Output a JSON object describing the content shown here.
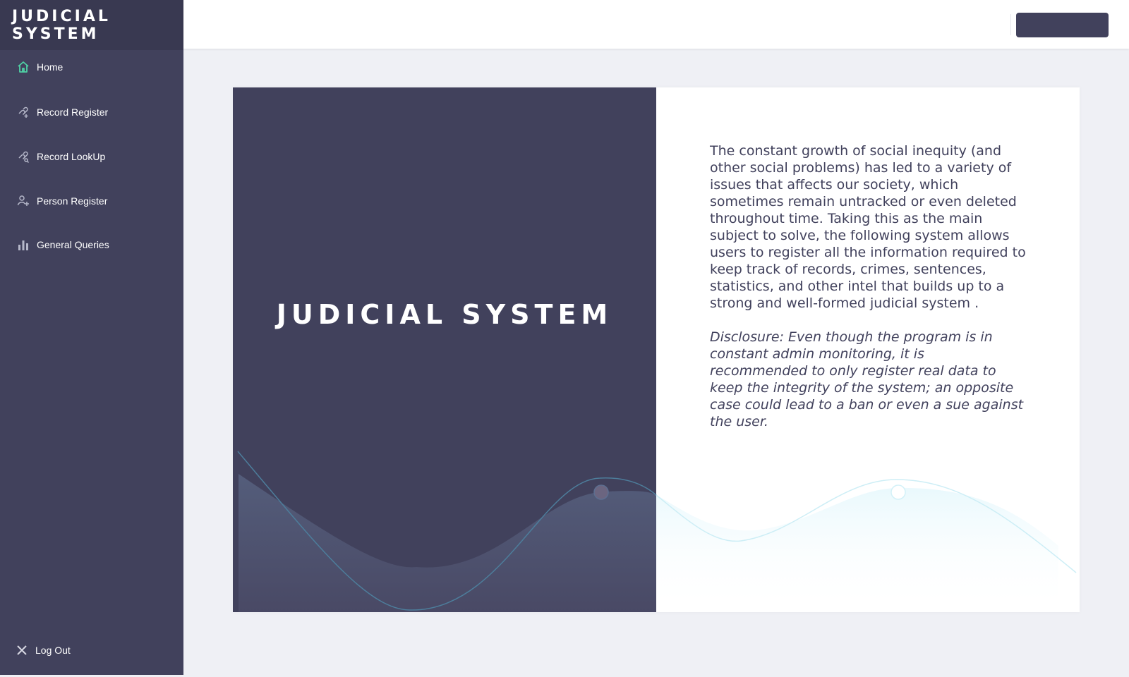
{
  "app": {
    "brand": "JUDICIAL SYSTEM"
  },
  "sidebar": {
    "items": [
      {
        "label": "Home",
        "icon": "home-icon",
        "active": true
      },
      {
        "label": "Record Register",
        "icon": "link-add-icon"
      },
      {
        "label": "Record LookUp",
        "icon": "link-search-icon"
      },
      {
        "label": "Person Register",
        "icon": "person-add-icon"
      },
      {
        "label": "General Queries",
        "icon": "bar-chart-icon"
      }
    ],
    "logout": {
      "label": "Log Out",
      "icon": "close-icon"
    }
  },
  "hero": {
    "title": "JUDICIAL SYSTEM"
  },
  "content": {
    "intro": "The constant growth of social inequity (and other social problems)  has led to a variety of issues that affects our society,  which sometimes remain untracked or even deleted throughout time. Taking this as the main subject to solve, the following system allows users to register all the information required to keep track of records, crimes, sentences, statistics, and other intel that builds up to a strong and well-formed judicial system .",
    "disclosure": "Disclosure: Even though the program is in constant admin monitoring, it is recommended to only register real data to keep the integrity of the system; an opposite case could lead to a ban or even a sue against the user."
  },
  "colors": {
    "sidebar": "#41415c",
    "brand_bar": "#393951",
    "accent": "#4fd1a5",
    "background": "#eff0f5",
    "icon_muted": "#b5b7c9"
  }
}
